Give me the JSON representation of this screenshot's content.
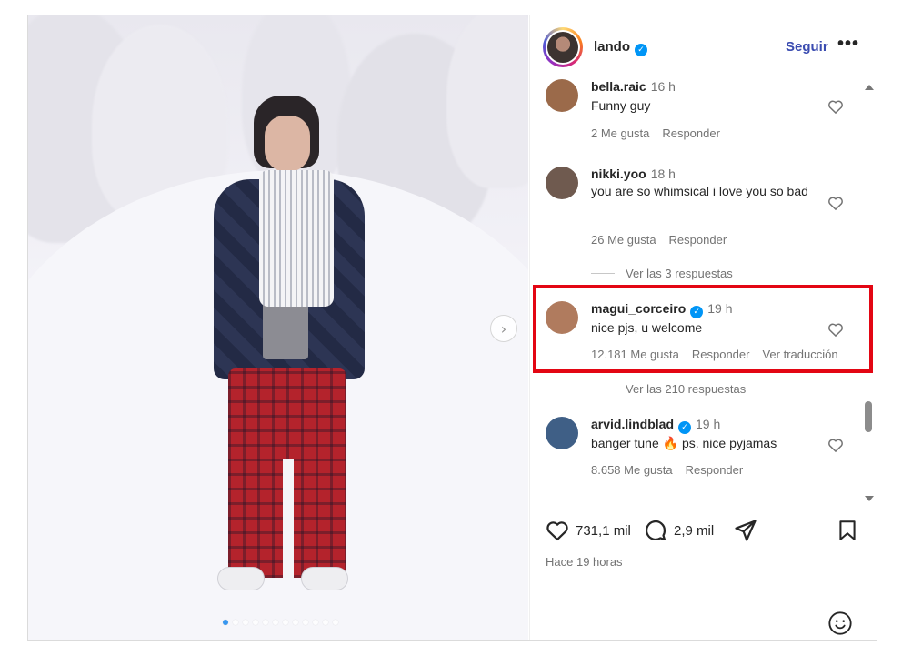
{
  "post": {
    "author": "lando",
    "follow_label": "Seguir",
    "more_label": "•••",
    "verified_mark": "✓",
    "next_arrow": "›",
    "carousel_dot_count": 12,
    "carousel_active_index": 0
  },
  "comments": [
    {
      "user": "bella.raic",
      "verified": false,
      "time": "16 h",
      "text": "Funny guy",
      "likes": "2 Me gusta",
      "reply": "Responder",
      "translate": "",
      "avatar_color": "#9b6a4a"
    },
    {
      "user": "nikki.yoo",
      "verified": false,
      "time": "18 h",
      "text": "you are so whimsical i love you so bad",
      "likes": "26 Me gusta",
      "reply": "Responder",
      "translate": "",
      "avatar_color": "#6f5a4f",
      "view_replies": "Ver las 3 respuestas"
    },
    {
      "user": "magui_corceiro",
      "verified": true,
      "time": "19 h",
      "text": "nice pjs, u welcome",
      "likes": "12.181 Me gusta",
      "reply": "Responder",
      "translate": "Ver traducción",
      "avatar_color": "#b07b5e",
      "view_replies": "Ver las 210 respuestas"
    },
    {
      "user": "arvid.lindblad",
      "verified": true,
      "time": "19 h",
      "text": "banger tune 🔥 ps. nice pyjamas",
      "likes": "8.658 Me gusta",
      "reply": "Responder",
      "translate": "",
      "avatar_color": "#3f5f86"
    }
  ],
  "actions": {
    "likes": "731,1 mil",
    "comments": "2,9 mil",
    "timestamp": "Hace 19 horas"
  },
  "colors": {
    "highlight": "#e30613",
    "follow": "#3a4bb0",
    "verified": "#0095f6"
  }
}
